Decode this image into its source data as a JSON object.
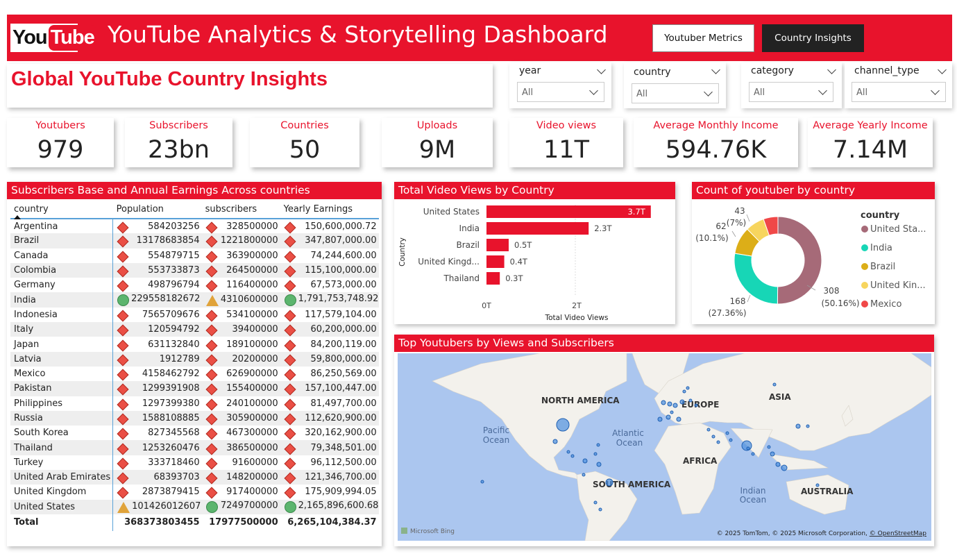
{
  "header": {
    "logo_you": "You",
    "logo_tube": "Tube",
    "title": "YouTube Analytics & Storytelling Dashboard",
    "nav": [
      {
        "label": "Youtuber Metrics"
      },
      {
        "label": "Country Insights"
      }
    ]
  },
  "page_title": "Global YouTube Country Insights",
  "slicers": [
    {
      "label": "year",
      "value": "All"
    },
    {
      "label": "country",
      "value": "All"
    },
    {
      "label": "category",
      "value": "All"
    },
    {
      "label": "channel_type",
      "value": "All"
    }
  ],
  "kpis": [
    {
      "title": "Youtubers",
      "value": "979"
    },
    {
      "title": "Subscribers",
      "value": "23bn"
    },
    {
      "title": "Countries",
      "value": "50"
    },
    {
      "title": "Uploads",
      "value": "9M"
    },
    {
      "title": "Video views",
      "value": "11T"
    },
    {
      "title": "Average Monthly Income",
      "value": "594.76K"
    },
    {
      "title": "Average Yearly Income",
      "value": "7.14M"
    }
  ],
  "matrix": {
    "title": "Subscribers Base and Annual Earnings Across countries",
    "columns": [
      "country",
      "Population",
      "subscribers",
      "Yearly Earnings"
    ],
    "rows": [
      {
        "country": "Argentina",
        "population": "584203256",
        "subscribers": "328500000",
        "earnings": "150,600,000.72",
        "icons": [
          "diamond",
          "diamond",
          "diamond"
        ]
      },
      {
        "country": "Brazil",
        "population": "13178683854",
        "subscribers": "1221800000",
        "earnings": "347,807,000.00",
        "icons": [
          "diamond",
          "diamond",
          "diamond"
        ]
      },
      {
        "country": "Canada",
        "population": "554879715",
        "subscribers": "363900000",
        "earnings": "74,244,600.00",
        "icons": [
          "diamond",
          "diamond",
          "diamond"
        ]
      },
      {
        "country": "Colombia",
        "population": "553733873",
        "subscribers": "264500000",
        "earnings": "115,100,000.00",
        "icons": [
          "diamond",
          "diamond",
          "diamond"
        ]
      },
      {
        "country": "Germany",
        "population": "498796794",
        "subscribers": "116400000",
        "earnings": "67,573,000.00",
        "icons": [
          "diamond",
          "diamond",
          "diamond"
        ]
      },
      {
        "country": "India",
        "population": "229558182672",
        "subscribers": "4310600000",
        "earnings": "1,791,753,748.92",
        "icons": [
          "circle",
          "triangle",
          "circle"
        ]
      },
      {
        "country": "Indonesia",
        "population": "7565709676",
        "subscribers": "534100000",
        "earnings": "117,579,104.00",
        "icons": [
          "diamond",
          "diamond",
          "diamond"
        ]
      },
      {
        "country": "Italy",
        "population": "120594792",
        "subscribers": "39400000",
        "earnings": "60,200,000.00",
        "icons": [
          "diamond",
          "diamond",
          "diamond"
        ]
      },
      {
        "country": "Japan",
        "population": "631132840",
        "subscribers": "189100000",
        "earnings": "84,200,119.00",
        "icons": [
          "diamond",
          "diamond",
          "diamond"
        ]
      },
      {
        "country": "Latvia",
        "population": "1912789",
        "subscribers": "20200000",
        "earnings": "59,800,000.00",
        "icons": [
          "diamond",
          "diamond",
          "diamond"
        ]
      },
      {
        "country": "Mexico",
        "population": "4158462792",
        "subscribers": "626900000",
        "earnings": "86,250,569.00",
        "icons": [
          "diamond",
          "diamond",
          "diamond"
        ]
      },
      {
        "country": "Pakistan",
        "population": "1299391908",
        "subscribers": "155400000",
        "earnings": "157,100,447.00",
        "icons": [
          "diamond",
          "diamond",
          "diamond"
        ]
      },
      {
        "country": "Philippines",
        "population": "1297399380",
        "subscribers": "240100000",
        "earnings": "81,497,700.00",
        "icons": [
          "diamond",
          "diamond",
          "diamond"
        ]
      },
      {
        "country": "Russia",
        "population": "1588108885",
        "subscribers": "305900000",
        "earnings": "112,620,900.00",
        "icons": [
          "diamond",
          "diamond",
          "diamond"
        ]
      },
      {
        "country": "South Korea",
        "population": "827345568",
        "subscribers": "467300000",
        "earnings": "320,162,900.00",
        "icons": [
          "diamond",
          "diamond",
          "diamond"
        ]
      },
      {
        "country": "Thailand",
        "population": "1253260476",
        "subscribers": "386500000",
        "earnings": "79,348,501.00",
        "icons": [
          "diamond",
          "diamond",
          "diamond"
        ]
      },
      {
        "country": "Turkey",
        "population": "333718460",
        "subscribers": "91600000",
        "earnings": "96,112,500.00",
        "icons": [
          "diamond",
          "diamond",
          "diamond"
        ]
      },
      {
        "country": "United Arab Emirates",
        "population": "68393703",
        "subscribers": "148200000",
        "earnings": "121,346,700.00",
        "icons": [
          "diamond",
          "diamond",
          "diamond"
        ]
      },
      {
        "country": "United Kingdom",
        "population": "2873879415",
        "subscribers": "917400000",
        "earnings": "175,909,994.05",
        "icons": [
          "diamond",
          "diamond",
          "diamond"
        ]
      },
      {
        "country": "United States",
        "population": "101426012607",
        "subscribers": "7249700000",
        "earnings": "2,165,896,600.68",
        "icons": [
          "triangle",
          "circle",
          "circle"
        ]
      }
    ],
    "total": {
      "label": "Total",
      "population": "368373803455",
      "subscribers": "17977500000",
      "earnings": "6,265,104,384.37"
    }
  },
  "views_chart": {
    "title": "Total Video Views by Country",
    "ylabel": "Country",
    "xlabel": "Total Video Views",
    "x_ticks": [
      "0T",
      "2T"
    ]
  },
  "donut": {
    "title": "Count of youtuber by country",
    "legend_title": "country",
    "legend": [
      "United Sta...",
      "India",
      "Brazil",
      "United Kin...",
      "Mexico"
    ],
    "labels": [
      {
        "count": "308",
        "pct": "(50.16%)"
      },
      {
        "count": "168",
        "pct": "(27.36%)"
      },
      {
        "count": "62",
        "pct": "(10.1%)"
      },
      {
        "count": "43",
        "pct": "(7%)"
      }
    ]
  },
  "map": {
    "title": "Top Youtubers by Views and Subscribers",
    "continents": [
      "NORTH AMERICA",
      "EUROPE",
      "ASIA",
      "AFRICA",
      "SOUTH AMERICA",
      "AUSTRALIA"
    ],
    "oceans": [
      "Pacific",
      "Ocean",
      "Atlantic",
      "Ocean",
      "Indian",
      "Ocean"
    ],
    "brand": "Microsoft Bing",
    "copyright": "© 2025 TomTom, © 2025 Microsoft Corporation, ",
    "osm": "© OpenStreetMap"
  },
  "chart_data": [
    {
      "type": "bar",
      "title": "Total Video Views by Country",
      "xlabel": "Total Video Views",
      "ylabel": "Country",
      "categories": [
        "United States",
        "India",
        "Brazil",
        "United Kingd...",
        "Thailand"
      ],
      "values": [
        3.7,
        2.3,
        0.5,
        0.4,
        0.3
      ],
      "value_labels": [
        "3.7T",
        "2.3T",
        "0.5T",
        "0.4T",
        "0.3T"
      ],
      "xlim": [
        0,
        4
      ],
      "color": "#e8132c"
    },
    {
      "type": "pie",
      "title": "Count of youtuber by country",
      "categories": [
        "United States",
        "India",
        "Brazil",
        "United Kingdom",
        "Mexico"
      ],
      "values": [
        308,
        168,
        62,
        43,
        33
      ],
      "colors": [
        "#a66a78",
        "#17d6b6",
        "#dcae18",
        "#f7d55e",
        "#f04848"
      ]
    }
  ]
}
